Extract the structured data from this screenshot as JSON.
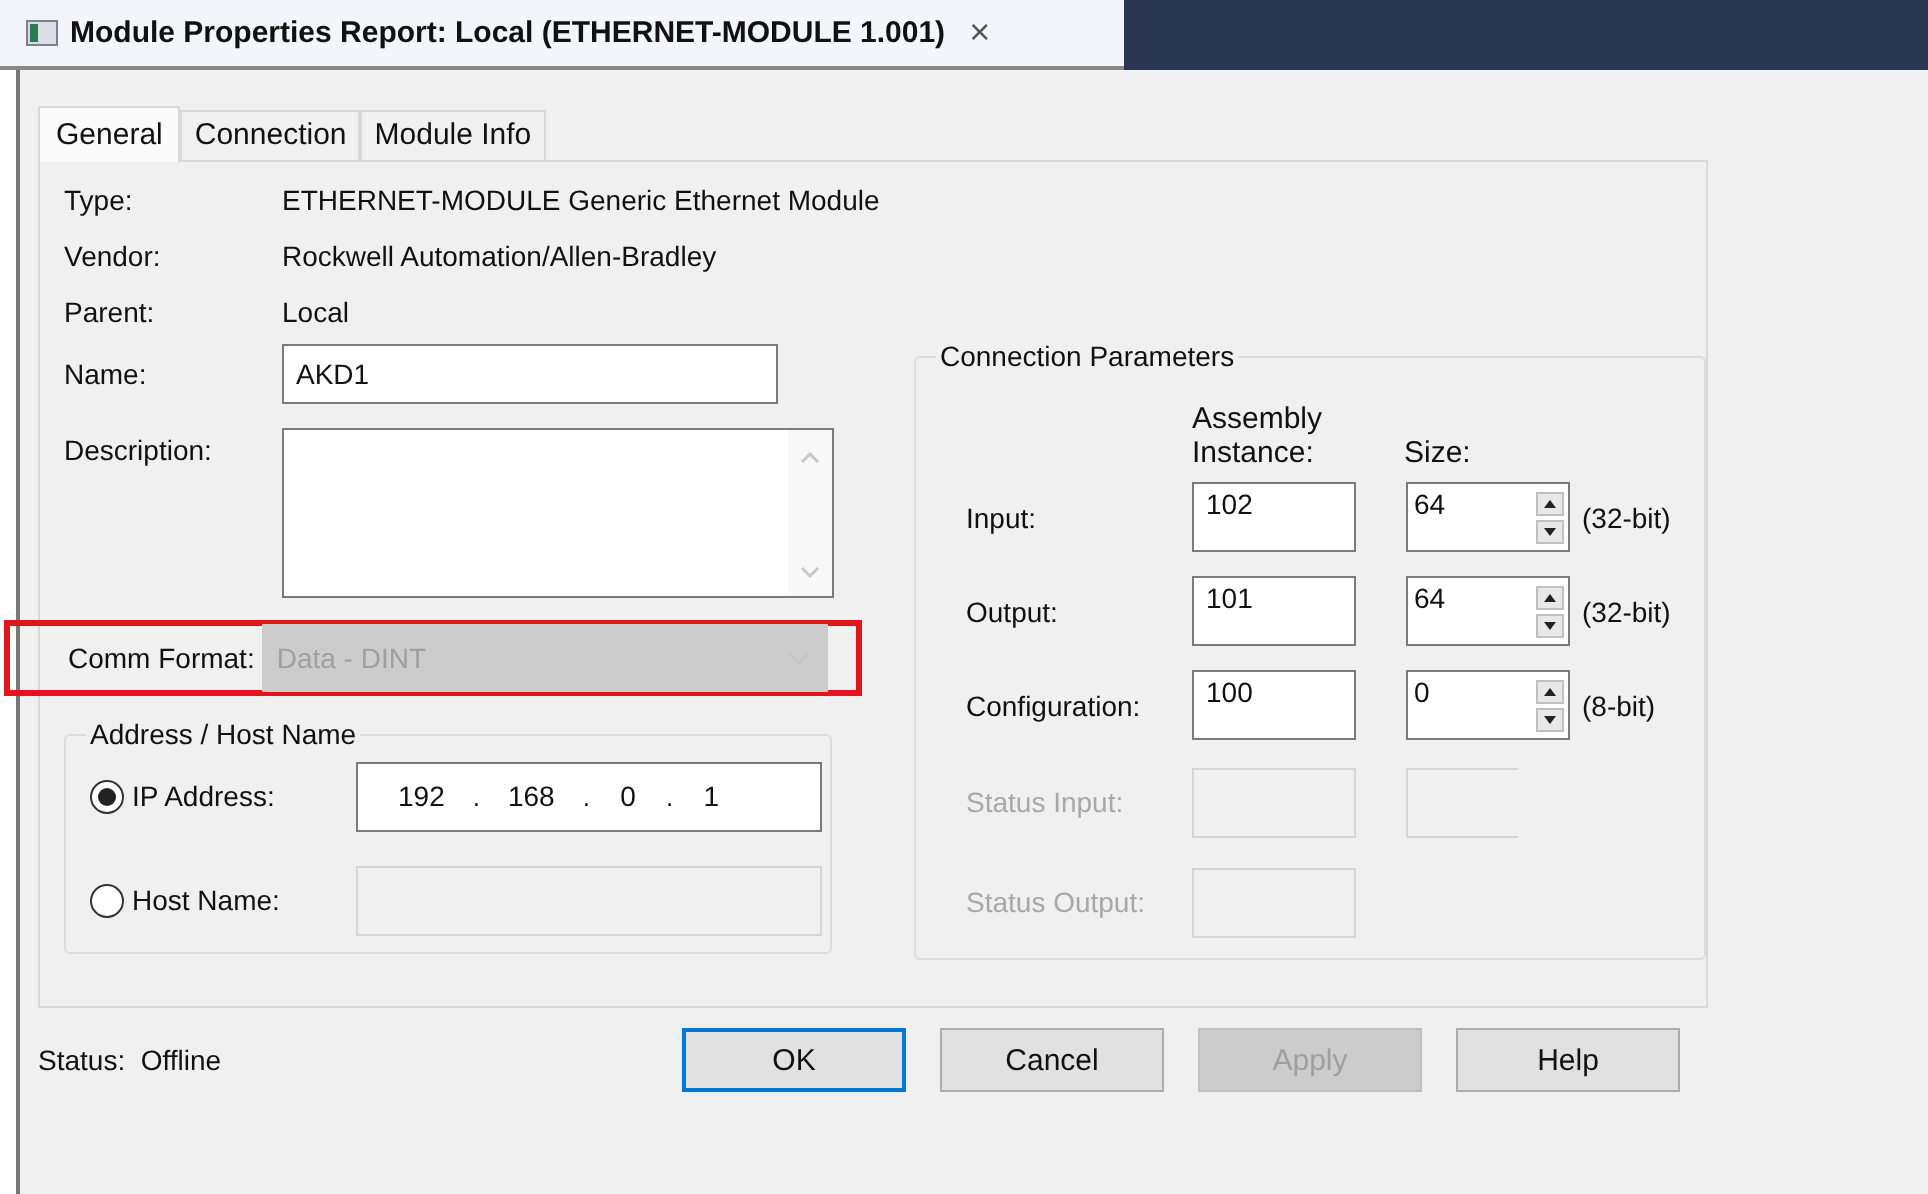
{
  "window": {
    "title": "Module Properties Report: Local (ETHERNET-MODULE 1.001)",
    "close": "×"
  },
  "tabs": [
    {
      "label": "General",
      "selected": true
    },
    {
      "label": "Connection",
      "selected": false
    },
    {
      "label": "Module Info",
      "selected": false
    }
  ],
  "info": [
    {
      "label": "Type:",
      "value": "ETHERNET-MODULE Generic Ethernet Module"
    },
    {
      "label": "Vendor:",
      "value": "Rockwell Automation/Allen-Bradley"
    },
    {
      "label": "Parent:",
      "value": "Local"
    }
  ],
  "name": {
    "label": "Name:",
    "value": "AKD1"
  },
  "description": {
    "label": "Description:"
  },
  "comm_format": {
    "label": "Comm Format:",
    "value": "Data - DINT",
    "disabled": true,
    "highlighted": true
  },
  "address": {
    "title": "Address / Host Name",
    "separator": ".",
    "options": [
      {
        "label": "IP Address:",
        "selected": true,
        "kind": "ip",
        "octets": [
          "192",
          "168",
          "0",
          "1"
        ],
        "disabled": false
      },
      {
        "label": "Host Name:",
        "selected": false,
        "kind": "host",
        "disabled": true
      }
    ]
  },
  "connection_parameters": {
    "title": "Connection Parameters",
    "columns": [
      "Assembly Instance:",
      "Size:"
    ],
    "rows": [
      {
        "kind": "param",
        "label": "Input:",
        "instance": "102",
        "size": "64",
        "unit": "(32-bit)"
      },
      {
        "kind": "param",
        "label": "Output:",
        "instance": "101",
        "size": "64",
        "unit": "(32-bit)"
      },
      {
        "kind": "param",
        "label": "Configuration:",
        "instance": "100",
        "size": "0",
        "unit": "(8-bit)"
      },
      {
        "kind": "status",
        "label": "Status Input:",
        "size_field": true
      },
      {
        "kind": "status",
        "label": "Status Output:",
        "size_field": false
      }
    ]
  },
  "status": {
    "label": "Status:",
    "value": "Offline"
  },
  "buttons": [
    {
      "label": "OK",
      "default": true,
      "disabled": false
    },
    {
      "label": "Cancel",
      "default": false,
      "disabled": false
    },
    {
      "label": "Apply",
      "default": false,
      "disabled": true
    },
    {
      "label": "Help",
      "default": false,
      "disabled": false
    }
  ]
}
